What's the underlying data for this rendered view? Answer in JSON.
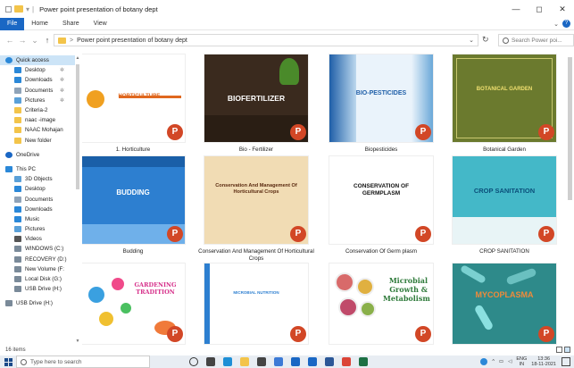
{
  "window": {
    "title": "Power point presentation of botany dept",
    "controls": {
      "minimize": "—",
      "maximize": "◻",
      "close": "✕"
    }
  },
  "ribbon": {
    "tabs": [
      "File",
      "Home",
      "Share",
      "View"
    ]
  },
  "address": {
    "back": "←",
    "forward": "→",
    "recent": "⌄",
    "up": "↑",
    "separator": ">",
    "path": "Power point presentation of botany dept",
    "dropdown": "⌄",
    "refresh": "↻",
    "search_placeholder": "Search Power poi..."
  },
  "nav": {
    "items": [
      {
        "label": "Quick access",
        "icon": "star-icon",
        "color": "#2b88d8",
        "level": 0,
        "selected": true,
        "pinned": false
      },
      {
        "label": "Desktop",
        "icon": "desktop-icon",
        "color": "#2b88d8",
        "level": 1,
        "pinned": true
      },
      {
        "label": "Downloads",
        "icon": "download-icon",
        "color": "#2b88d8",
        "level": 1,
        "pinned": true
      },
      {
        "label": "Documents",
        "icon": "documents-icon",
        "color": "#8fa3b8",
        "level": 1,
        "pinned": true
      },
      {
        "label": "Pictures",
        "icon": "pictures-icon",
        "color": "#5aa0d8",
        "level": 1,
        "pinned": true
      },
      {
        "label": "Criteria-2",
        "icon": "folder-icon",
        "color": "#f3c44a",
        "level": 1,
        "pinned": false
      },
      {
        "label": "naac -image",
        "icon": "folder-icon",
        "color": "#f3c44a",
        "level": 1,
        "pinned": false
      },
      {
        "label": "NAAC Mohajan",
        "icon": "folder-icon",
        "color": "#f3c44a",
        "level": 1,
        "pinned": false
      },
      {
        "label": "New folder",
        "icon": "folder-icon",
        "color": "#f3c44a",
        "level": 1,
        "pinned": false
      },
      {
        "label": "",
        "gap": true
      },
      {
        "label": "OneDrive",
        "icon": "cloud-icon",
        "color": "#1a67c4",
        "level": 0,
        "pinned": false
      },
      {
        "label": "",
        "gap": true
      },
      {
        "label": "This PC",
        "icon": "pc-icon",
        "color": "#2b88d8",
        "level": 0,
        "pinned": false
      },
      {
        "label": "3D Objects",
        "icon": "cube-icon",
        "color": "#5aa0d8",
        "level": 1,
        "pinned": false
      },
      {
        "label": "Desktop",
        "icon": "desktop-icon",
        "color": "#2b88d8",
        "level": 1,
        "pinned": false
      },
      {
        "label": "Documents",
        "icon": "documents-icon",
        "color": "#8fa3b8",
        "level": 1,
        "pinned": false
      },
      {
        "label": "Downloads",
        "icon": "download-icon",
        "color": "#2b88d8",
        "level": 1,
        "pinned": false
      },
      {
        "label": "Music",
        "icon": "music-icon",
        "color": "#2b88d8",
        "level": 1,
        "pinned": false
      },
      {
        "label": "Pictures",
        "icon": "pictures-icon",
        "color": "#5aa0d8",
        "level": 1,
        "pinned": false
      },
      {
        "label": "Videos",
        "icon": "videos-icon",
        "color": "#555555",
        "level": 1,
        "pinned": false
      },
      {
        "label": "WINDOWS (C:)",
        "icon": "drive-icon",
        "color": "#7a8a99",
        "level": 1,
        "pinned": false
      },
      {
        "label": "RECOVERY (D:)",
        "icon": "drive-icon",
        "color": "#7a8a99",
        "level": 1,
        "pinned": false
      },
      {
        "label": "New Volume (F:",
        "icon": "drive-icon",
        "color": "#7a8a99",
        "level": 1,
        "pinned": false
      },
      {
        "label": "Local Disk (G:)",
        "icon": "drive-icon",
        "color": "#7a8a99",
        "level": 1,
        "pinned": false
      },
      {
        "label": "USB Drive (H:)",
        "icon": "usb-icon",
        "color": "#7a8a99",
        "level": 1,
        "pinned": false
      },
      {
        "label": "",
        "gap": true
      },
      {
        "label": "USB Drive (H:)",
        "icon": "usb-icon",
        "color": "#7a8a99",
        "level": 0,
        "pinned": false
      }
    ],
    "pin_glyph": "✲",
    "scroll_up": "▲",
    "scroll_down": "▼"
  },
  "files": [
    {
      "name": "1. Horticulture",
      "slide_title": "HORTICULTURE",
      "bg": "#ffffff",
      "title_color": "#e0681f",
      "variant": "horti"
    },
    {
      "name": "Bio - Fertilizer",
      "slide_title": "BIOFERTILIZER",
      "bg": "#3a2a1e",
      "title_color": "#ffffff",
      "variant": "biofert"
    },
    {
      "name": "Biopesticides",
      "slide_title": "BIO-PESTICIDES",
      "bg": "#eaf3fb",
      "title_color": "#1f5fa8",
      "variant": "biopest"
    },
    {
      "name": "Botanical Garden",
      "slide_title": "BOTANICAL GARDEN",
      "bg": "#6b7a2e",
      "title_color": "#f0e070",
      "variant": "garden"
    },
    {
      "name": "Budding",
      "slide_title": "BUDDING",
      "bg": "#2d7fd0",
      "title_color": "#ffffff",
      "variant": "budding"
    },
    {
      "name": "Conservation And Management Of Horticultural Crops",
      "slide_title": "Conservation And Management Of Horticultural Crops",
      "bg": "#f1dcb4",
      "title_color": "#5a2a10",
      "variant": "conserv"
    },
    {
      "name": "Conservation Of Germ plasm",
      "slide_title": "CONSERVATION OF GERMPLASM",
      "bg": "#ffffff",
      "title_color": "#111111",
      "variant": "germ"
    },
    {
      "name": "CROP SANITATION",
      "slide_title": "CROP SANITATION",
      "bg": "#44b8c8",
      "title_color": "#0b4f7a",
      "variant": "crop"
    },
    {
      "name": "",
      "slide_title": "GARDENING TRADITION",
      "bg": "#ffffff",
      "title_color": "#d6308a",
      "variant": "gardening"
    },
    {
      "name": "",
      "slide_title": "MICROBIAL NUTRITION",
      "bg": "#ffffff",
      "title_color": "#2d7fd0",
      "variant": "micronut"
    },
    {
      "name": "",
      "slide_title": "Microbial Growth & Metabolism",
      "bg": "#ffffff",
      "title_color": "#2e7a3a",
      "variant": "microgrowth"
    },
    {
      "name": "",
      "slide_title": "MYCOPLASMA",
      "bg": "#2e8a8a",
      "title_color": "#f08a3a",
      "variant": "myco"
    }
  ],
  "ppt_badge": "P",
  "status": {
    "count": "16 items"
  },
  "taskbar": {
    "search_placeholder": "Type here to search",
    "apps": [
      {
        "name": "cortana-icon",
        "color": "#333333"
      },
      {
        "name": "taskview-icon",
        "color": "#444444"
      },
      {
        "name": "edge-icon",
        "color": "#1e8fd6"
      },
      {
        "name": "file-explorer-icon",
        "color": "#f3c44a"
      },
      {
        "name": "store-icon",
        "color": "#444444"
      },
      {
        "name": "security-icon",
        "color": "#3c7ad6"
      },
      {
        "name": "mail-icon",
        "color": "#1a67c4"
      },
      {
        "name": "onedrive-icon",
        "color": "#1a67c4"
      },
      {
        "name": "word-icon",
        "color": "#2b5797"
      },
      {
        "name": "chrome-icon",
        "color": "#db4437"
      },
      {
        "name": "excel-icon",
        "color": "#1d7044"
      }
    ],
    "lang": "ENG",
    "lang_sub": "IN",
    "time": "13:36",
    "date": "18-11-2021"
  }
}
